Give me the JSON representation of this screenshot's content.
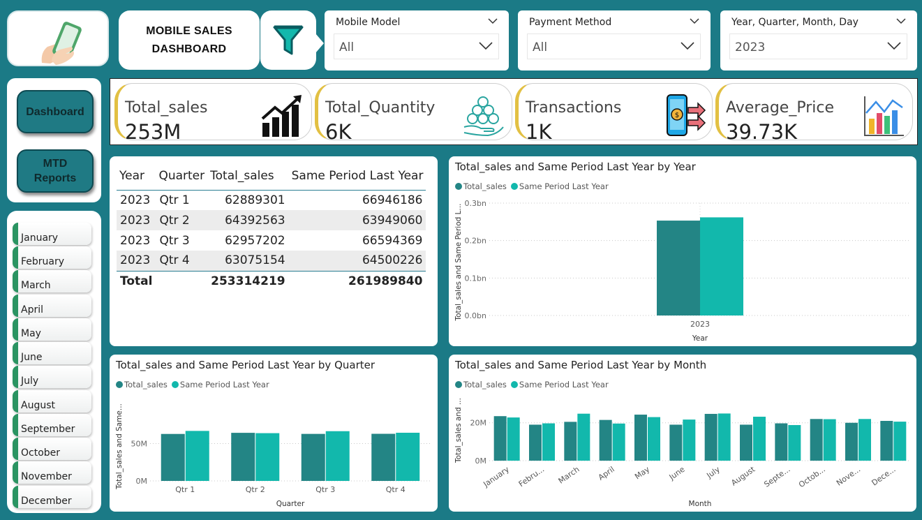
{
  "header": {
    "title_line1": "MOBILE SALES",
    "title_line2": "DASHBOARD"
  },
  "icons": {
    "logo": "phone-in-hand-icon",
    "filter": "funnel-icon"
  },
  "slicers": [
    {
      "label": "Mobile Model",
      "value": "All"
    },
    {
      "label": "Payment Method",
      "value": "All"
    },
    {
      "label": "Year, Quarter, Month, Day",
      "value": "2023"
    }
  ],
  "nav": {
    "dashboard": "Dashboard",
    "mtd_line1": "MTD",
    "mtd_line2": "Reports"
  },
  "months": [
    "January",
    "February",
    "March",
    "April",
    "May",
    "June",
    "July",
    "August",
    "September",
    "October",
    "November",
    "December"
  ],
  "kpis": [
    {
      "label": "Total_sales",
      "value": "253M",
      "icon": "rising-bar-chart-icon"
    },
    {
      "label": "Total_Quantity",
      "value": "6K",
      "icon": "coins-in-hand-icon"
    },
    {
      "label": "Transactions",
      "value": "1K",
      "icon": "phone-payment-icon"
    },
    {
      "label": "Average_Price",
      "value": "39.73K",
      "icon": "bar-chart-trend-icon"
    }
  ],
  "table": {
    "headers": [
      "Year",
      "Quarter",
      "Total_sales",
      "Same Period Last Year"
    ],
    "rows": [
      [
        "2023",
        "Qtr 1",
        "62889301",
        "66946186"
      ],
      [
        "2023",
        "Qtr 2",
        "64392563",
        "63949060"
      ],
      [
        "2023",
        "Qtr 3",
        "62957202",
        "66594369"
      ],
      [
        "2023",
        "Qtr 4",
        "63075154",
        "64500226"
      ]
    ],
    "total_label": "Total",
    "total_sales": "253314219",
    "total_last_year": "261989840"
  },
  "colors": {
    "background": "#1b7a86",
    "series_current": "#238585",
    "series_last_year": "#12b8ac",
    "kpi_accent": "#e2c043",
    "month_accent": "#2a9462"
  },
  "chart_data": [
    {
      "type": "bar",
      "title": "Total_sales and Same Period Last Year by Year",
      "xlabel": "Year",
      "ylabel": "Total_sales and Same Period L...",
      "categories": [
        "2023"
      ],
      "series": [
        {
          "name": "Total_sales",
          "values": [
            253314219
          ]
        },
        {
          "name": "Same Period Last Year",
          "values": [
            261989840
          ]
        }
      ],
      "yticks": [
        "0.0bn",
        "0.1bn",
        "0.2bn",
        "0.3bn"
      ],
      "ylim": [
        0,
        300000000
      ],
      "legend": "top-left",
      "grid": true
    },
    {
      "type": "bar",
      "title": "Total_sales and Same Period Last Year by Quarter",
      "xlabel": "Quarter",
      "ylabel": "Total_sales and Same...",
      "categories": [
        "Qtr 1",
        "Qtr 2",
        "Qtr 3",
        "Qtr 4"
      ],
      "series": [
        {
          "name": "Total_sales",
          "values": [
            62889301,
            64392563,
            62957202,
            63075154
          ]
        },
        {
          "name": "Same Period Last Year",
          "values": [
            66946186,
            63949060,
            66594369,
            64500226
          ]
        }
      ],
      "yticks": [
        "0M",
        "50M"
      ],
      "ylim": [
        0,
        100000000
      ],
      "legend": "top-left",
      "grid": true
    },
    {
      "type": "bar",
      "title": "Total_sales and Same Period Last Year by Month",
      "xlabel": "Month",
      "ylabel": "Total_sales and ...",
      "categories": [
        "January",
        "Febru...",
        "March",
        "April",
        "May",
        "June",
        "July",
        "August",
        "Septe...",
        "Octob...",
        "Nove...",
        "Dece..."
      ],
      "series": [
        {
          "name": "Total_sales",
          "values": [
            23500000,
            19000000,
            20500000,
            21500000,
            24300000,
            19000000,
            24700000,
            19000000,
            19700000,
            22000000,
            20000000,
            21000000
          ]
        },
        {
          "name": "Same Period Last Year",
          "values": [
            22800000,
            19700000,
            24800000,
            19600000,
            23000000,
            21700000,
            24900000,
            23200000,
            18800000,
            21900000,
            22000000,
            20600000
          ]
        }
      ],
      "yticks": [
        "0M",
        "20M"
      ],
      "ylim": [
        0,
        35000000
      ],
      "legend": "top-left",
      "grid": true
    }
  ]
}
